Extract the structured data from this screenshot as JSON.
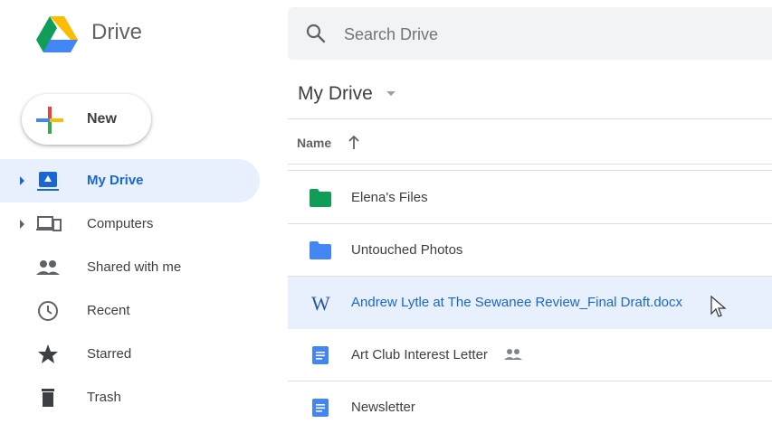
{
  "app": {
    "title": "Drive"
  },
  "search": {
    "placeholder": "Search Drive"
  },
  "new_button": {
    "label": "New"
  },
  "sidebar": {
    "items": [
      {
        "label": "My Drive",
        "icon": "my-drive-icon",
        "active": true,
        "expandable": true
      },
      {
        "label": "Computers",
        "icon": "computers-icon",
        "active": false,
        "expandable": true
      },
      {
        "label": "Shared with me",
        "icon": "shared-with-me-icon",
        "active": false,
        "expandable": false
      },
      {
        "label": "Recent",
        "icon": "clock-icon",
        "active": false,
        "expandable": false
      },
      {
        "label": "Starred",
        "icon": "star-icon",
        "active": false,
        "expandable": false
      },
      {
        "label": "Trash",
        "icon": "trash-icon",
        "active": false,
        "expandable": false
      }
    ]
  },
  "main": {
    "title": "My Drive",
    "column_header": "Name",
    "sort": "ascending",
    "files": [
      {
        "name": "Elena's Files",
        "type": "folder",
        "icon": "green-folder-icon",
        "color": "#0f9d58"
      },
      {
        "name": "Untouched Photos",
        "type": "folder",
        "icon": "folder-icon",
        "color": "#4285f4"
      },
      {
        "name": "Andrew Lytle at The Sewanee Review_Final Draft.docx",
        "type": "word",
        "icon": "word-doc-icon",
        "selected": true
      },
      {
        "name": "Art Club Interest Letter",
        "type": "doc",
        "icon": "google-doc-icon",
        "shared": true
      },
      {
        "name": "Newsletter",
        "type": "doc",
        "icon": "google-doc-icon"
      }
    ]
  },
  "colors": {
    "accent": "#1967d2",
    "selected_bg": "#e8f0fe",
    "search_bg": "#f1f3f4",
    "doc_blue": "#4285f4",
    "folder_green": "#0f9d58"
  }
}
